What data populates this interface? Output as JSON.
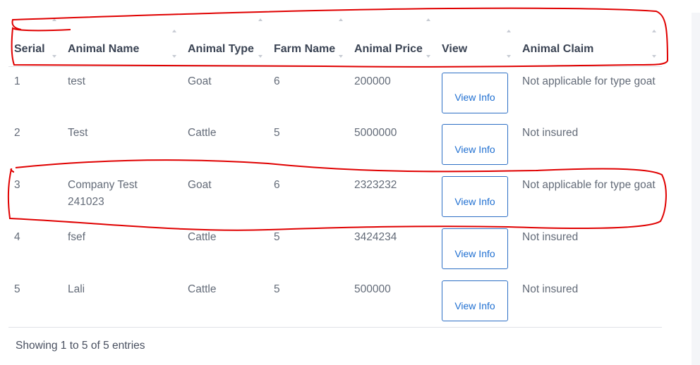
{
  "table": {
    "columns": [
      {
        "label": "Serial"
      },
      {
        "label": "Animal Name"
      },
      {
        "label": "Animal Type"
      },
      {
        "label": "Farm Name"
      },
      {
        "label": "Animal Price"
      },
      {
        "label": "View"
      },
      {
        "label": "Animal Claim"
      }
    ],
    "rows": [
      {
        "serial": "1",
        "name": "test",
        "type": "Goat",
        "farm": "6",
        "price": "200000",
        "view": "View Info",
        "claim": "Not applicable for type goat"
      },
      {
        "serial": "2",
        "name": "Test",
        "type": "Cattle",
        "farm": "5",
        "price": "5000000",
        "view": "View Info",
        "claim": "Not insured"
      },
      {
        "serial": "3",
        "name": "Company Test 241023",
        "type": "Goat",
        "farm": "6",
        "price": "2323232",
        "view": "View Info",
        "claim": "Not applicable for type goat"
      },
      {
        "serial": "4",
        "name": "fsef",
        "type": "Cattle",
        "farm": "5",
        "price": "3424234",
        "view": "View Info",
        "claim": "Not insured"
      },
      {
        "serial": "5",
        "name": "Lali",
        "type": "Cattle",
        "farm": "5",
        "price": "500000",
        "view": "View Info",
        "claim": "Not insured"
      }
    ]
  },
  "footer": {
    "info": "Showing 1 to 5 of 5 entries"
  },
  "colors": {
    "annotation": "#e00000",
    "button_border": "#2d6fc5",
    "button_text": "#1f6fd1"
  }
}
